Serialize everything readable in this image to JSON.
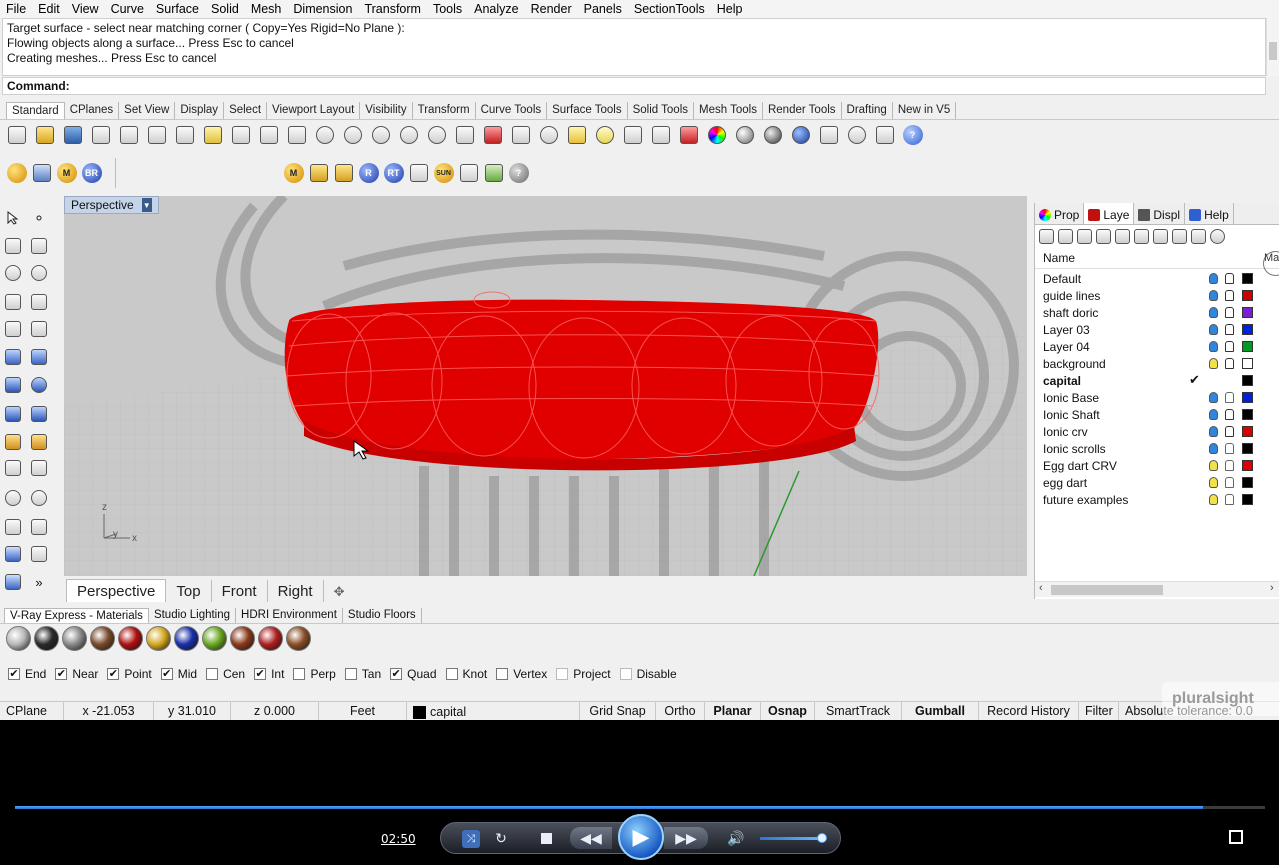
{
  "menu": [
    "File",
    "Edit",
    "View",
    "Curve",
    "Surface",
    "Solid",
    "Mesh",
    "Dimension",
    "Transform",
    "Tools",
    "Analyze",
    "Render",
    "Panels",
    "SectionTools",
    "Help"
  ],
  "history": [
    "Target surface - select near matching corner ( Copy=Yes  Rigid=No  Plane ):",
    "Flowing objects along a surface... Press Esc to cancel",
    "Creating meshes... Press Esc to cancel"
  ],
  "command_label": "Command:",
  "toolbar_tabs": [
    "Standard",
    "CPlanes",
    "Set View",
    "Display",
    "Select",
    "Viewport Layout",
    "Visibility",
    "Transform",
    "Curve Tools",
    "Surface Tools",
    "Solid Tools",
    "Mesh Tools",
    "Render Tools",
    "Drafting",
    "New in V5"
  ],
  "toolbar2_labels": [
    "M",
    "BR",
    "M",
    "R",
    "RT",
    "SUN"
  ],
  "viewport": {
    "title": "Perspective",
    "axis_z": "z",
    "axis_y": "y",
    "axis_x": "x"
  },
  "view_tabs": [
    "Perspective",
    "Top",
    "Front",
    "Right"
  ],
  "right_panel": {
    "tabs": [
      "Prop",
      "Laye",
      "Displ",
      "Help"
    ],
    "name_header": "Name",
    "mat_header": "Mat",
    "layers": [
      {
        "name": "Default",
        "color": "#000000",
        "bulb": "#2e86de",
        "locked": true
      },
      {
        "name": "guide lines",
        "color": "#cc0000",
        "bulb": "#2e86de",
        "locked": true
      },
      {
        "name": "shaft doric",
        "color": "#7a1fd1",
        "bulb": "#2e86de",
        "locked": true
      },
      {
        "name": "Layer 03",
        "color": "#0022dd",
        "bulb": "#2e86de",
        "locked": true
      },
      {
        "name": "Layer 04",
        "color": "#009922",
        "bulb": "#2e86de",
        "locked": true
      },
      {
        "name": "background",
        "color": "#ffffff",
        "bulb": "#f2e24a",
        "locked": true
      },
      {
        "name": "capital",
        "color": "#000000",
        "bulb": "",
        "locked": false,
        "current": true
      },
      {
        "name": "Ionic Base",
        "color": "#0022dd",
        "bulb": "#2e86de",
        "locked": false
      },
      {
        "name": "Ionic Shaft",
        "color": "#000000",
        "bulb": "#2e86de",
        "locked": true
      },
      {
        "name": "Ionic crv",
        "color": "#dd0000",
        "bulb": "#2e86de",
        "locked": true
      },
      {
        "name": "Ionic scrolls",
        "color": "#000000",
        "bulb": "#2e86de",
        "locked": false
      },
      {
        "name": "Egg dart CRV",
        "color": "#dd0000",
        "bulb": "#f2e24a",
        "locked": false
      },
      {
        "name": "egg dart",
        "color": "#000000",
        "bulb": "#f2e24a",
        "locked": false
      },
      {
        "name": "future examples",
        "color": "#000000",
        "bulb": "#f2e24a",
        "locked": false
      }
    ]
  },
  "material_tabs": [
    "V-Ray Express - Materials",
    "Studio Lighting",
    "HDRI Environment",
    "Studio Floors"
  ],
  "material_swatches": [
    "#b8b8b8",
    "#2a2a2a",
    "#8a8a8a",
    "#7a4a2a",
    "#b01010",
    "#d4a820",
    "#1a2fa8",
    "#6aa820",
    "#8a3a1a",
    "#b02020",
    "#8a5028"
  ],
  "osnaps": [
    {
      "label": "End",
      "checked": true
    },
    {
      "label": "Near",
      "checked": true
    },
    {
      "label": "Point",
      "checked": true
    },
    {
      "label": "Mid",
      "checked": true
    },
    {
      "label": "Cen",
      "checked": false
    },
    {
      "label": "Int",
      "checked": true
    },
    {
      "label": "Perp",
      "checked": false
    },
    {
      "label": "Tan",
      "checked": false
    },
    {
      "label": "Quad",
      "checked": true
    },
    {
      "label": "Knot",
      "checked": false
    },
    {
      "label": "Vertex",
      "checked": false
    },
    {
      "label": "Project",
      "checked": false,
      "dim": true
    },
    {
      "label": "Disable",
      "checked": false,
      "dim": true
    }
  ],
  "status": {
    "cplane": "CPlane",
    "x": "x -21.053",
    "y": "y 31.010",
    "z": "z 0.000",
    "units": "Feet",
    "layer": "capital",
    "grid_snap": "Grid Snap",
    "ortho": "Ortho",
    "planar": "Planar",
    "osnap": "Osnap",
    "smarttrack": "SmartTrack",
    "gumball": "Gumball",
    "record_history": "Record History",
    "filter": "Filter",
    "tolerance": "Absolute tolerance: 0.0"
  },
  "watermark": "pluralsight",
  "player": {
    "time": "02:50",
    "progress": 0.95
  }
}
